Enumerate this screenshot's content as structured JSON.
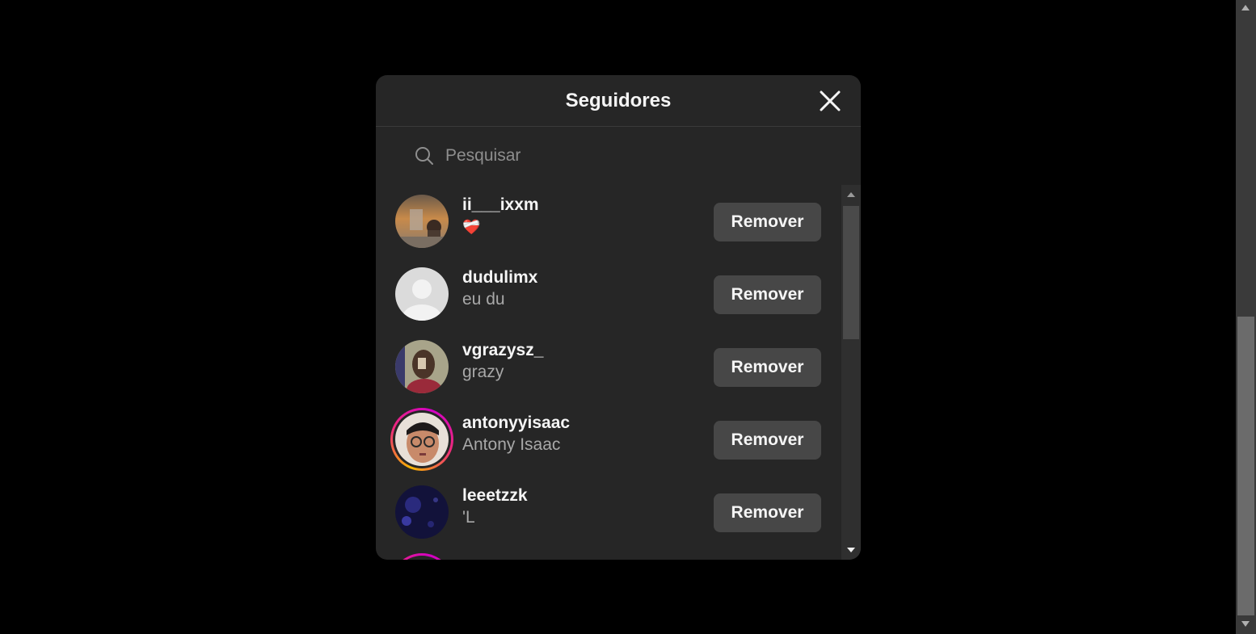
{
  "modal": {
    "title": "Seguidores",
    "close_icon": "close-icon"
  },
  "search": {
    "placeholder": "Pesquisar",
    "value": "",
    "icon": "search-icon"
  },
  "followers": [
    {
      "username": "ii___ixxm",
      "fullname": "❤️‍🩹",
      "avatar": "photo-sunset",
      "story": false,
      "button": "Remover"
    },
    {
      "username": "dudulimx",
      "fullname": "eu du",
      "avatar": "default-avatar",
      "story": false,
      "button": "Remover"
    },
    {
      "username": "vgrazysz_",
      "fullname": "grazy",
      "avatar": "photo-mirror-selfie",
      "story": false,
      "button": "Remover"
    },
    {
      "username": "antonyyisaac",
      "fullname": "Antony Isaac",
      "avatar": "photo-selfie-glasses",
      "story": true,
      "button": "Remover"
    },
    {
      "username": "leeetzzk",
      "fullname": "'L",
      "avatar": "photo-jellyfish",
      "story": false,
      "button": "Remover"
    }
  ],
  "colors": {
    "background": "#000000",
    "modal": "#262626",
    "button": "#474747",
    "text_primary": "#f5f5f5",
    "text_secondary": "#a8a8a8"
  }
}
